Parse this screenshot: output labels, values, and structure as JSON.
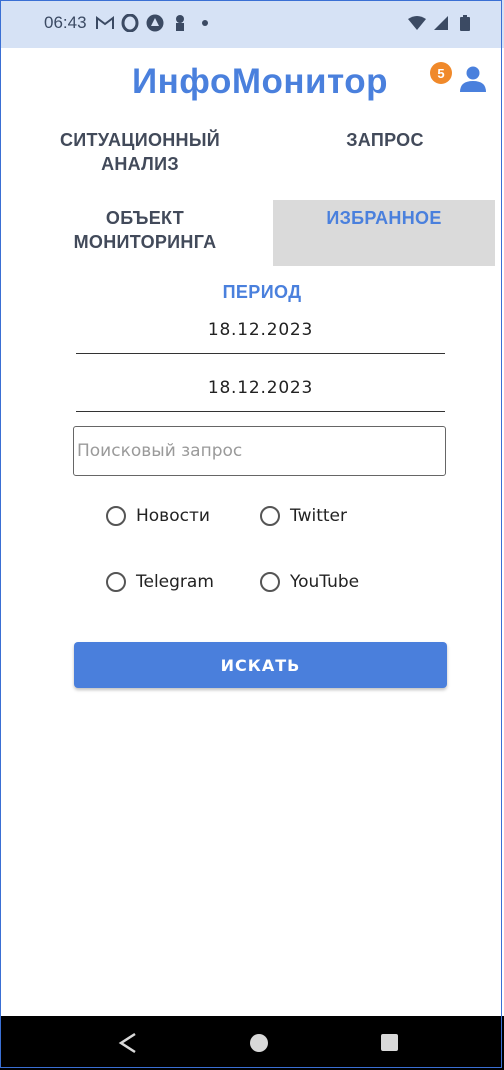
{
  "status_bar": {
    "time": "06:43",
    "left_icons": [
      "gmail-icon",
      "opera-icon",
      "app-icon",
      "notification-icon",
      "dot-icon"
    ],
    "right_icons": [
      "wifi-icon",
      "signal-icon",
      "battery-icon"
    ]
  },
  "header": {
    "title": "ИнфоМонитор",
    "badge_count": "5",
    "profile_icon": "person-icon"
  },
  "tabs": {
    "situation": "СИТУАЦИОННЫЙ АНАЛИЗ",
    "request": "ЗАПРОС",
    "object": "ОБЪЕКТ МОНИТОРИНГА",
    "favorite": "ИЗБРАННОЕ",
    "active": "favorite"
  },
  "form": {
    "period_label": "ПЕРИОД",
    "date_from": "18.12.2023",
    "date_to": "18.12.2023",
    "search_placeholder": "Поисковый запрос",
    "sources": {
      "news": "Новости",
      "twitter": "Twitter",
      "telegram": "Telegram",
      "youtube": "YouTube"
    },
    "submit_label": "ИСКАТЬ"
  },
  "colors": {
    "accent": "#4a80dd",
    "status_bar_bg": "#d6e2f5",
    "badge": "#f0892a",
    "active_tab_bg": "#dadada",
    "nav_bar": "#000000"
  }
}
